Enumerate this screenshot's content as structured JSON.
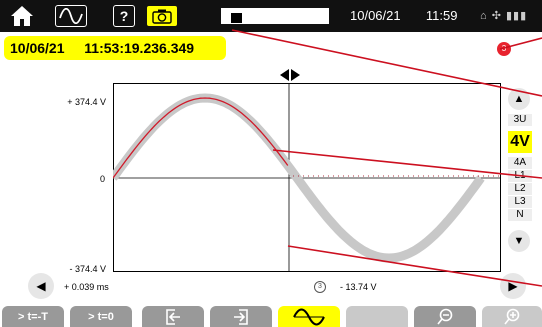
{
  "topbar": {
    "home_icon": "home-icon",
    "tab_waveform_icon": "waveform-icon",
    "tab_help_label": "?",
    "tab_camera_icon": "camera-icon",
    "progress_level": 0.1,
    "date": "10/06/21",
    "time": "11:59",
    "status_icons": "⌂ ✣ ▮▮▮"
  },
  "timestamp": {
    "date": "10/06/21",
    "time": "11:53:19.236.349"
  },
  "record_badge": "3",
  "chart_data": {
    "type": "line",
    "title": "",
    "xlabel": "",
    "ylabel": "",
    "ytick_top": "+ 374.4 V",
    "ytick_mid": "0",
    "ytick_bottom": "- 374.4 V",
    "ylim": [
      -374.4,
      374.4
    ],
    "series": [
      {
        "values": [
          0,
          180,
          325,
          374,
          325,
          180,
          0,
          -180,
          -325,
          -374,
          -325,
          -180,
          0
        ]
      }
    ]
  },
  "right_panel": {
    "items": [
      "3U",
      "4A",
      "L1",
      "L2",
      "L3",
      "N"
    ],
    "selected": "4V"
  },
  "cursor_info": {
    "time": "+ 0.039 ms",
    "channel": "3",
    "value": "- 13.74 V"
  },
  "softkeys": [
    {
      "label": "> t=-T"
    },
    {
      "label": "> t=0"
    },
    {
      "label": "",
      "icon": "exit-left-icon"
    },
    {
      "label": "",
      "icon": "exit-right-icon"
    },
    {
      "label": "",
      "icon": "wave-icon"
    },
    {
      "label": ""
    },
    {
      "label": "",
      "icon": "zoom-out-icon"
    },
    {
      "label": "",
      "icon": "zoom-in-icon"
    }
  ]
}
